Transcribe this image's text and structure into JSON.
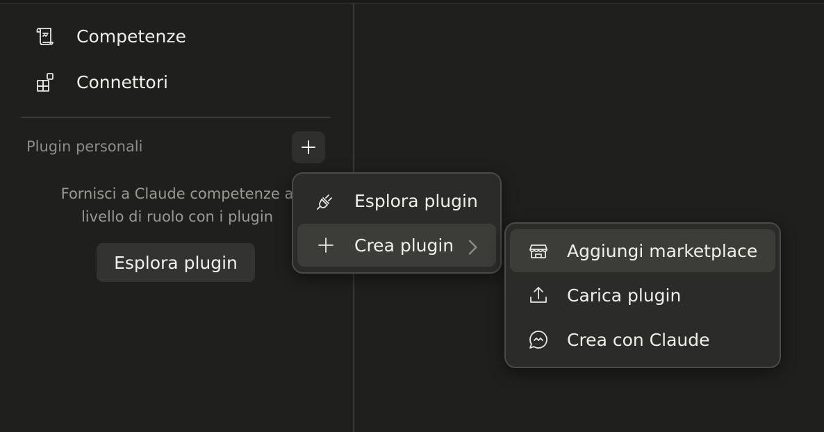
{
  "sidebar": {
    "nav": [
      {
        "label": "Competenze",
        "icon": "scroll-icon"
      },
      {
        "label": "Connettori",
        "icon": "grid-blocks-icon"
      }
    ],
    "section_label": "Plugin personali",
    "empty_text": "Fornisci a Claude competenze a\nlivello di ruolo con i plugin",
    "explore_button": "Esplora plugin"
  },
  "menu": {
    "items": [
      {
        "label": "Esplora plugin",
        "icon": "plug-icon"
      },
      {
        "label": "Crea plugin",
        "icon": "plus-icon",
        "has_submenu": true
      }
    ]
  },
  "submenu": {
    "items": [
      {
        "label": "Aggiungi marketplace",
        "icon": "store-icon"
      },
      {
        "label": "Carica plugin",
        "icon": "upload-icon"
      },
      {
        "label": "Crea con Claude",
        "icon": "chat-bubble-icon"
      }
    ]
  }
}
